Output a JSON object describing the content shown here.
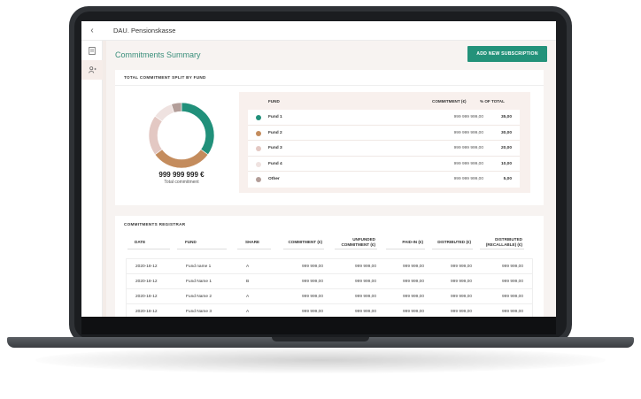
{
  "app": {
    "title": "DAU. Pensionskasse"
  },
  "summary": {
    "title": "Commitments Summary",
    "add_button": "ADD NEW SUBSCRIPTION"
  },
  "split": {
    "label": "TOTAL COMMITMENT SPLIT BY FUND",
    "total_value": "999 999 999 €",
    "total_label": "Total commitment",
    "headers": {
      "fund": "FUND",
      "commitment": "COMMITMENT (€)",
      "pct": "% OF TOTAL"
    },
    "rows": [
      {
        "name": "Fund 1",
        "commitment": "999 999 999,00",
        "pct": "35,00",
        "color": "#21907a"
      },
      {
        "name": "Fund 2",
        "commitment": "999 999 999,00",
        "pct": "30,00",
        "color": "#c48c5d"
      },
      {
        "name": "Fund 3",
        "commitment": "999 999 999,00",
        "pct": "20,00",
        "color": "#e3c8c3"
      },
      {
        "name": "Fund 4",
        "commitment": "999 999 999,00",
        "pct": "10,00",
        "color": "#efe2e0"
      },
      {
        "name": "Other",
        "commitment": "999 999 999,00",
        "pct": "5,00",
        "color": "#b39e99"
      }
    ]
  },
  "chart_data": {
    "type": "pie",
    "categories": [
      "Fund 1",
      "Fund 2",
      "Fund 3",
      "Fund 4",
      "Other"
    ],
    "values": [
      35,
      30,
      20,
      10,
      5
    ]
  },
  "registrar": {
    "label": "COMMITMENTS REGISTRAR",
    "headers": {
      "date": "DATE",
      "fund": "FUND",
      "share": "SHARE",
      "commitment": "COMMITMENT (€)",
      "unfunded_1": "UNFUNDED",
      "unfunded_2": "COMMITMENT (€)",
      "paid_in": "PAID-IN (€)",
      "distributed": "DISTRIBUTED (€)",
      "recallable_1": "DISTRIBUTED",
      "recallable_2": "(RECALLABLE) (€)"
    },
    "rows": [
      {
        "date": "2020-18-12",
        "fund": "Fund name 1",
        "share": "A",
        "commitment": "999 999,00",
        "unfunded": "999 999,00",
        "paid_in": "999 999,00",
        "distributed": "999 999,00",
        "recallable": "999 999,00"
      },
      {
        "date": "2020-18-12",
        "fund": "Fund Name 1",
        "share": "B",
        "commitment": "999 999,00",
        "unfunded": "999 999,00",
        "paid_in": "999 999,00",
        "distributed": "999 999,00",
        "recallable": "999 999,00"
      },
      {
        "date": "2020-18-12",
        "fund": "Fund Name 2",
        "share": "A",
        "commitment": "999 999,00",
        "unfunded": "999 999,00",
        "paid_in": "999 999,00",
        "distributed": "999 999,00",
        "recallable": "999 999,00"
      },
      {
        "date": "2020-18-12",
        "fund": "Fund Name 3",
        "share": "A",
        "commitment": "999 999,00",
        "unfunded": "999 999,00",
        "paid_in": "999 999,00",
        "distributed": "999 999,00",
        "recallable": "999 999,00"
      }
    ]
  },
  "icons": {
    "back": "chevron-left-icon",
    "document": "document-icon",
    "user_add": "user-add-icon"
  }
}
